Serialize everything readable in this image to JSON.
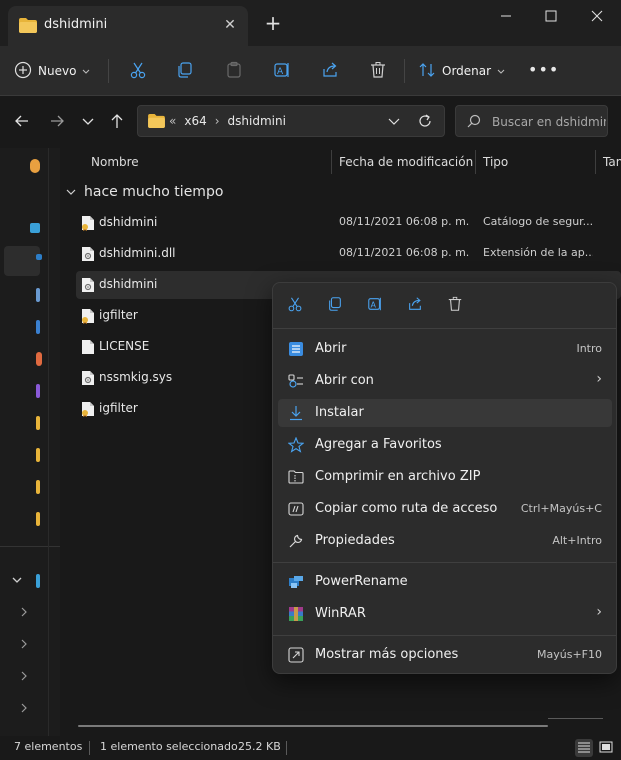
{
  "window": {
    "tab_title": "dshidmini",
    "close_tab_glyph": "✕",
    "new_tab_glyph": "+"
  },
  "toolbar": {
    "new_label": "Nuevo",
    "order_label": "Ordenar",
    "more_glyph": "•••"
  },
  "address": {
    "overflow": "«",
    "crumbs": [
      "x64",
      "dshidmini"
    ],
    "separator": "›"
  },
  "search": {
    "placeholder": "Buscar en dshidmini"
  },
  "columns": {
    "name": "Nombre",
    "date": "Fecha de modificación",
    "type": "Tipo",
    "size": "Tam"
  },
  "group": {
    "label": "hace mucho tiempo"
  },
  "files": [
    {
      "name": "dshidmini",
      "date": "08/11/2021 06:08 p. m.",
      "type": "Catálogo de segur...",
      "icon": "catalog-icon"
    },
    {
      "name": "dshidmini.dll",
      "date": "08/11/2021 06:08 p. m.",
      "type": "Extensión de la ap...",
      "icon": "dll-icon"
    },
    {
      "name": "dshidmini",
      "date": "",
      "type": "",
      "icon": "inf-icon"
    },
    {
      "name": "igfilter",
      "date": "",
      "type": "",
      "icon": "catalog-icon"
    },
    {
      "name": "LICENSE",
      "date": "",
      "type": "",
      "icon": "file-icon"
    },
    {
      "name": "nssmkig.sys",
      "date": "",
      "type": "",
      "icon": "sys-icon"
    },
    {
      "name": "igfilter",
      "date": "",
      "type": "",
      "icon": "catalog-icon"
    }
  ],
  "context_menu": {
    "items": [
      {
        "label": "Abrir",
        "accel": "Intro"
      },
      {
        "label": "Abrir con",
        "accel": "",
        "submenu": true
      },
      {
        "label": "Instalar",
        "accel": ""
      },
      {
        "label": "Agregar a Favoritos",
        "accel": ""
      },
      {
        "label": "Comprimir en archivo ZIP",
        "accel": ""
      },
      {
        "label": "Copiar como ruta de acceso",
        "accel": "Ctrl+Mayús+C"
      },
      {
        "label": "Propiedades",
        "accel": "Alt+Intro"
      },
      {
        "label": "PowerRename",
        "accel": ""
      },
      {
        "label": "WinRAR",
        "accel": "",
        "submenu": true
      },
      {
        "label": "Mostrar más opciones",
        "accel": "Mayús+F10"
      }
    ],
    "submenu_glyph": "›"
  },
  "status": {
    "count": "7 elementos",
    "selected": "1 elemento seleccionado",
    "size": "25.2 KB"
  },
  "colors": {
    "folder": "#e8b43a",
    "accent": "#4aa3f0"
  }
}
